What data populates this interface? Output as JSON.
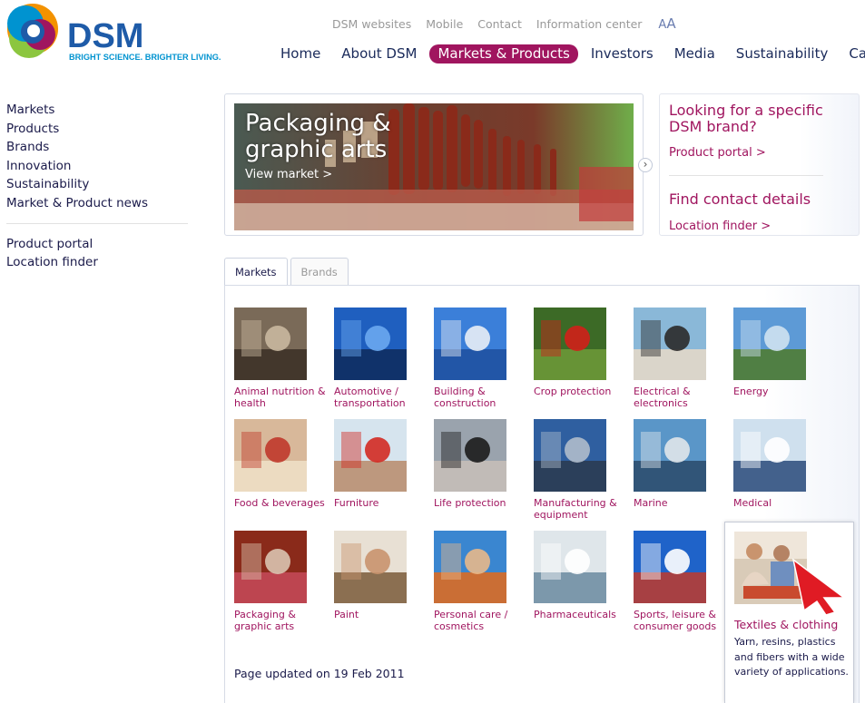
{
  "brand": {
    "name": "DSM",
    "tagline": "BRIGHT SCIENCE. BRIGHTER LIVING."
  },
  "utility_nav": [
    "DSM websites",
    "Mobile",
    "Contact",
    "Information center"
  ],
  "text_size": {
    "small": "A",
    "large": "A"
  },
  "main_nav": [
    {
      "label": "Home",
      "active": false
    },
    {
      "label": "About DSM",
      "active": false
    },
    {
      "label": "Markets & Products",
      "active": true
    },
    {
      "label": "Investors",
      "active": false
    },
    {
      "label": "Media",
      "active": false
    },
    {
      "label": "Sustainability",
      "active": false
    },
    {
      "label": "Careers",
      "active": false
    }
  ],
  "sidebar": {
    "group1": [
      "Markets",
      "Products",
      "Brands",
      "Innovation",
      "Sustainability",
      "Market & Product news"
    ],
    "group2": [
      "Product portal",
      "Location finder"
    ]
  },
  "banner": {
    "title_line1": "Packaging &",
    "title_line2": "graphic arts",
    "link": "View market >"
  },
  "right_box": {
    "brand_heading": "Looking for a specific DSM brand?",
    "brand_link": "Product portal >",
    "contact_heading": "Find contact details",
    "contact_link": "Location finder >"
  },
  "tabs": [
    {
      "label": "Markets",
      "active": true
    },
    {
      "label": "Brands",
      "active": false
    }
  ],
  "markets": [
    {
      "label": "Animal nutrition & health",
      "icon": "cows-photo"
    },
    {
      "label": "Automotive / transportation",
      "icon": "car-photo"
    },
    {
      "label": "Building & construction",
      "icon": "bridge-photo"
    },
    {
      "label": "Crop protection",
      "icon": "tomato-photo"
    },
    {
      "label": "Electrical & electronics",
      "icon": "woman-laptop-photo"
    },
    {
      "label": "Energy",
      "icon": "field-sky-photo"
    },
    {
      "label": "Food & beverages",
      "icon": "kids-eating-photo"
    },
    {
      "label": "Furniture",
      "icon": "couple-sofa-photo"
    },
    {
      "label": "Life protection",
      "icon": "police-photo"
    },
    {
      "label": "Manufacturing & equipment",
      "icon": "factory-photo"
    },
    {
      "label": "Marine",
      "icon": "sailing-photo"
    },
    {
      "label": "Medical",
      "icon": "doctor-xray-photo"
    },
    {
      "label": "Packaging & graphic arts",
      "icon": "supermarket-photo"
    },
    {
      "label": "Paint",
      "icon": "painting-photo"
    },
    {
      "label": "Personal care / cosmetics",
      "icon": "woman-sunscreen-photo"
    },
    {
      "label": "Pharmaceuticals",
      "icon": "pharmacy-photo"
    },
    {
      "label": "Sports, leisure & consumer goods",
      "icon": "ski-photo"
    }
  ],
  "popup": {
    "title": "Textiles & clothing",
    "description": "Yarn, resins, plastics and fibers with a wide variety of applications.",
    "icon": "textile-workers-photo"
  },
  "page_updated": "Page updated on 19 Feb 2011",
  "colors": {
    "accent": "#a0155f",
    "navy": "#1a2a5a",
    "brand_blue": "#1e5ba8"
  }
}
